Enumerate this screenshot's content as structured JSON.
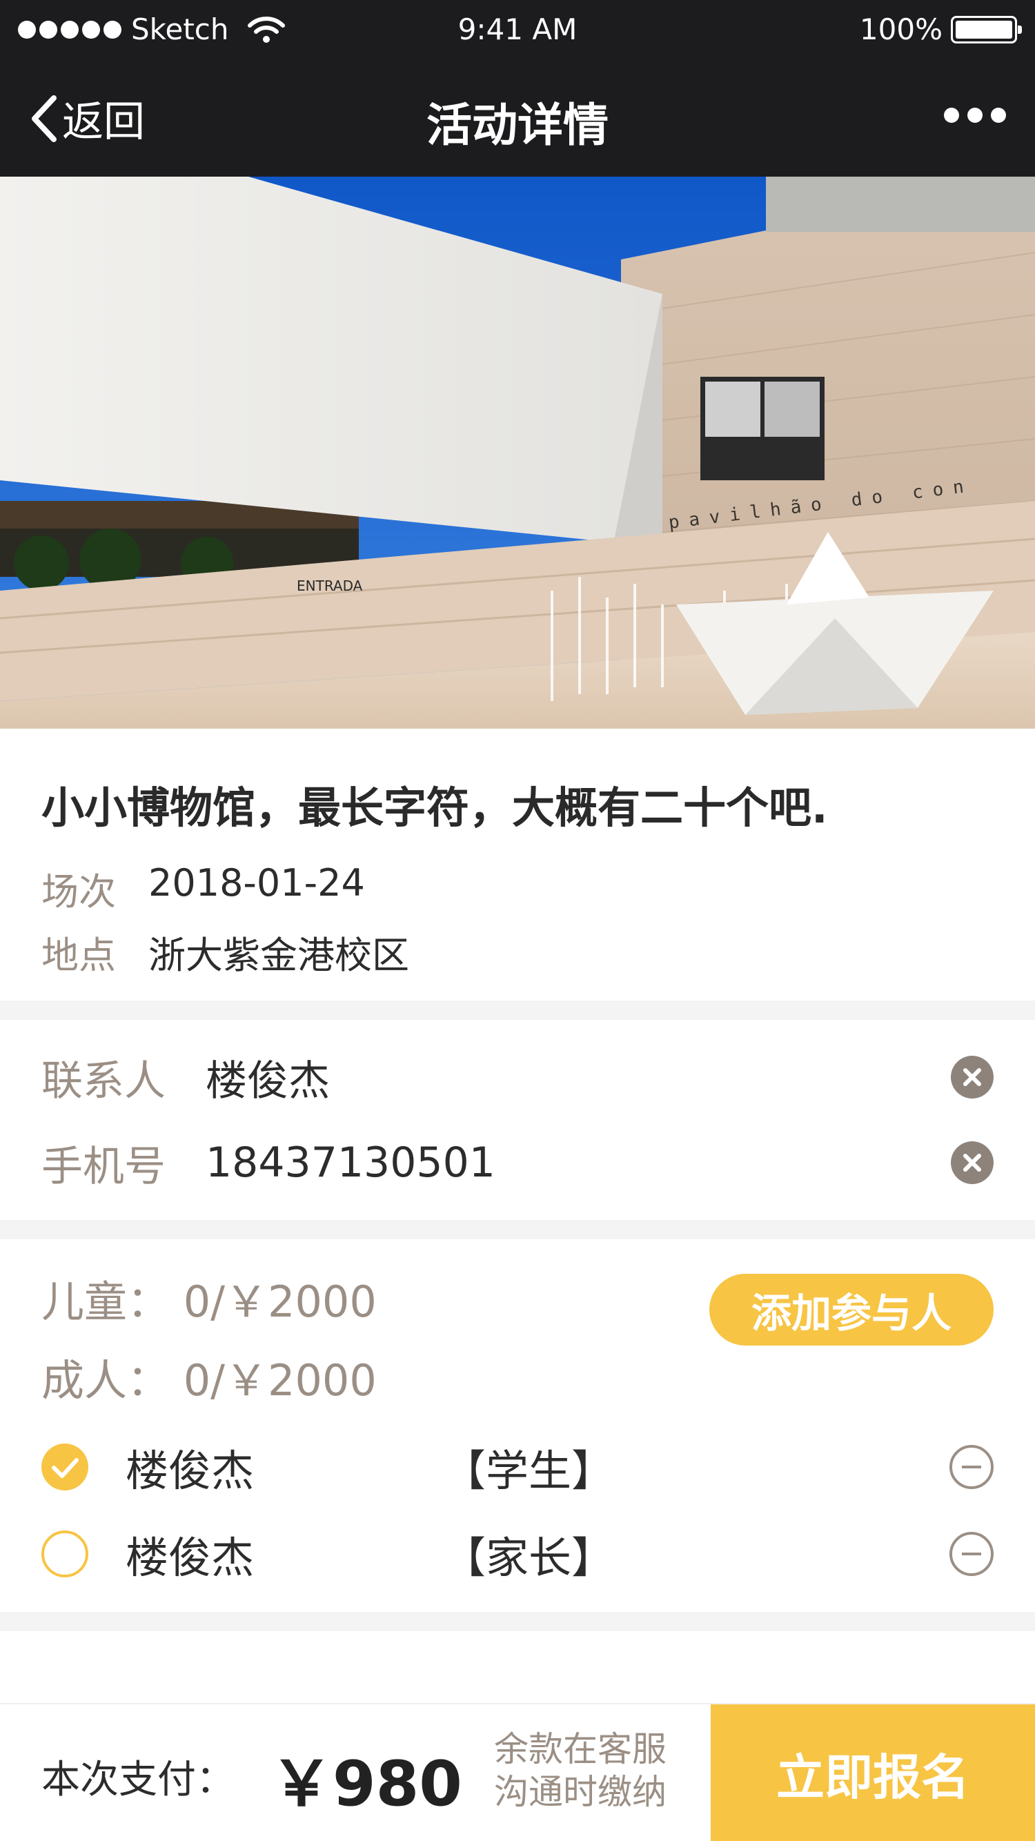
{
  "status_bar": {
    "carrier": "Sketch",
    "time": "9:41 AM",
    "battery": "100%"
  },
  "nav": {
    "back_label": "返回",
    "title": "活动详情"
  },
  "event": {
    "title": "小小博物馆，最长字符，大概有二十个吧.",
    "session_label": "场次",
    "session_value": "2018-01-24",
    "place_label": "地点",
    "place_value": "浙大紫金港校区"
  },
  "contact": {
    "name_label": "联系人",
    "name_value": "楼俊杰",
    "phone_label": "手机号",
    "phone_value": "18437130501"
  },
  "participants": {
    "child_price": "儿童：  0/￥2000",
    "adult_price": "成人：  0/￥2000",
    "add_button": "添加参与人",
    "list": [
      {
        "name": "楼俊杰",
        "role": "【学生】",
        "checked": true
      },
      {
        "name": "楼俊杰",
        "role": "【家长】",
        "checked": false
      }
    ]
  },
  "footer": {
    "pay_label": "本次支付：",
    "pay_amount": "￥980",
    "note_line1": "余款在客服",
    "note_line2": "沟通时缴纳",
    "submit": "立即报名"
  },
  "colors": {
    "accent": "#f7c444",
    "nav_bg": "#1c1c1e",
    "muted_text": "#9b8f85"
  }
}
